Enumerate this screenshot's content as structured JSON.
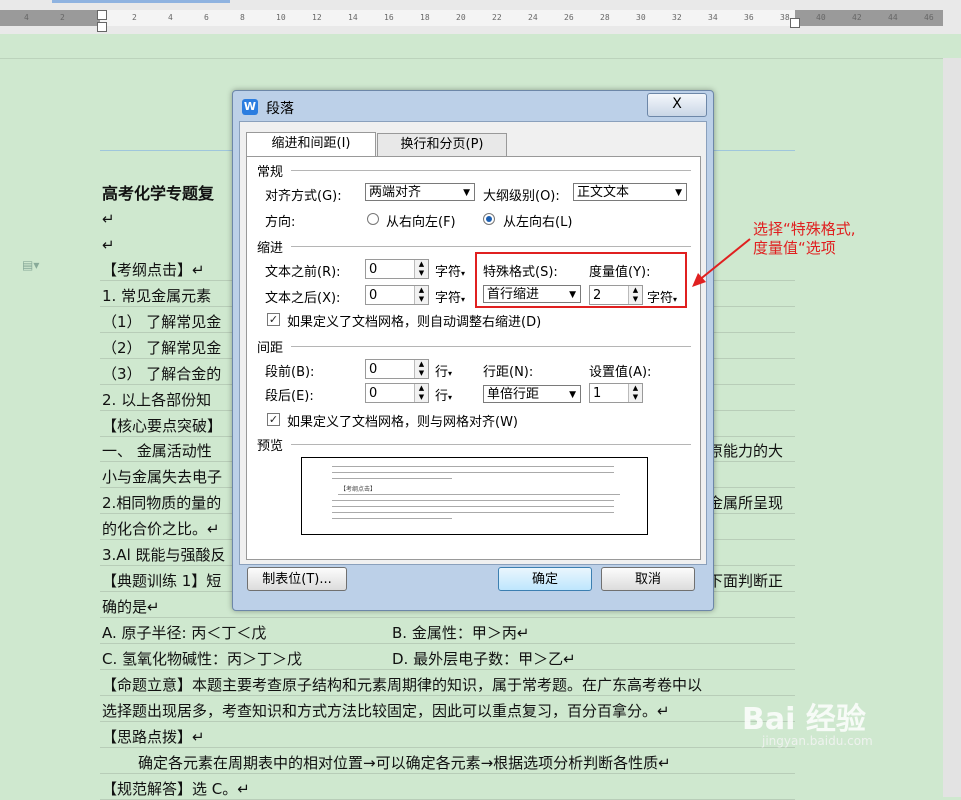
{
  "ruler": {
    "ticks": [
      "4",
      "2",
      "",
      "2",
      "4",
      "6",
      "8",
      "10",
      "12",
      "14",
      "16",
      "18",
      "20",
      "22",
      "24",
      "26",
      "28",
      "30",
      "32",
      "34",
      "36",
      "38",
      "40",
      "42",
      "44",
      "46"
    ]
  },
  "document": {
    "lines": [
      "高考化学专题复",
      "↵",
      "↵",
      "【考纲点击】↵",
      "1. 常见金属元素",
      "（1）  了解常见金",
      "（2）  了解常见金",
      "（3）  了解合金的",
      "2. 以上各部份知",
      "【核心要点突破】",
      "一、  金属活动性",
      "小与金属失去电子",
      "2.相同物质的量的",
      "的化合价之比。↵",
      "3.Al 既能与强酸反",
      "【典题训练 1】短",
      "确的是↵",
      "A. 原子半径:  丙＜丁＜戊",
      "C. 氢氧化物碱性：丙＞丁＞戊",
      "【命题立意】本题主要考查原子结构和元素周期律的知识，属于常考题。在广东高考卷中以",
      "选择题出现居多，考查知识和方式方法比较固定，因此可以重点复习，百分百拿分。↵",
      "【思路点拨】↵",
      "确定各元素在周期表中的相对位置→可以确定各元素→根据选项分析判断各性质↵",
      "【规范解答】选 C。↵"
    ],
    "right_fragments": {
      "line10": "原能力的大",
      "line12": "金属所呈现",
      "line15": "下面判断正",
      "optB": "B. 金属性：甲＞丙↵",
      "optD": "D. 最外层电子数：甲＞乙↵"
    }
  },
  "dialog": {
    "title": "段落",
    "close": "X",
    "tabs": [
      "缩进和间距(I)",
      "换行和分页(P)"
    ],
    "general": {
      "section": "常规",
      "align_label": "对齐方式(G):",
      "align_value": "两端对齐",
      "outline_label": "大纲级别(O):",
      "outline_value": "正文文本",
      "direction_label": "方向:",
      "rtl": "从右向左(F)",
      "ltr": "从左向右(L)"
    },
    "indent": {
      "section": "缩进",
      "before_label": "文本之前(R):",
      "before_value": "0",
      "after_label": "文本之后(X):",
      "after_value": "0",
      "unit": "字符",
      "special_label": "特殊格式(S):",
      "special_value": "首行缩进",
      "measure_label": "度量值(Y):",
      "measure_value": "2",
      "grid_check": "如果定义了文档网格，则自动调整右缩进(D)"
    },
    "spacing": {
      "section": "间距",
      "before_label": "段前(B):",
      "before_value": "0",
      "after_label": "段后(E):",
      "after_value": "0",
      "unit": "行",
      "line_label": "行距(N):",
      "line_value": "单倍行距",
      "set_label": "设置值(A):",
      "set_value": "1",
      "grid_check": "如果定义了文档网格，则与网格对齐(W)"
    },
    "preview_label": "预览",
    "preview_heading": "【考纲点击】",
    "buttons": {
      "tabs": "制表位(T)...",
      "ok": "确定",
      "cancel": "取消"
    }
  },
  "annotation": {
    "line1": "选择“特殊格式,",
    "line2": "度量值“选项"
  },
  "watermark": {
    "brand": "Bai 经验",
    "url": "jingyan.baidu.com"
  },
  "colors": {
    "page_bg": "#cfe8cf",
    "dialog_frame": "#bcd0e8",
    "annotation": "#e02020",
    "primary_button": "#bee6fd"
  }
}
